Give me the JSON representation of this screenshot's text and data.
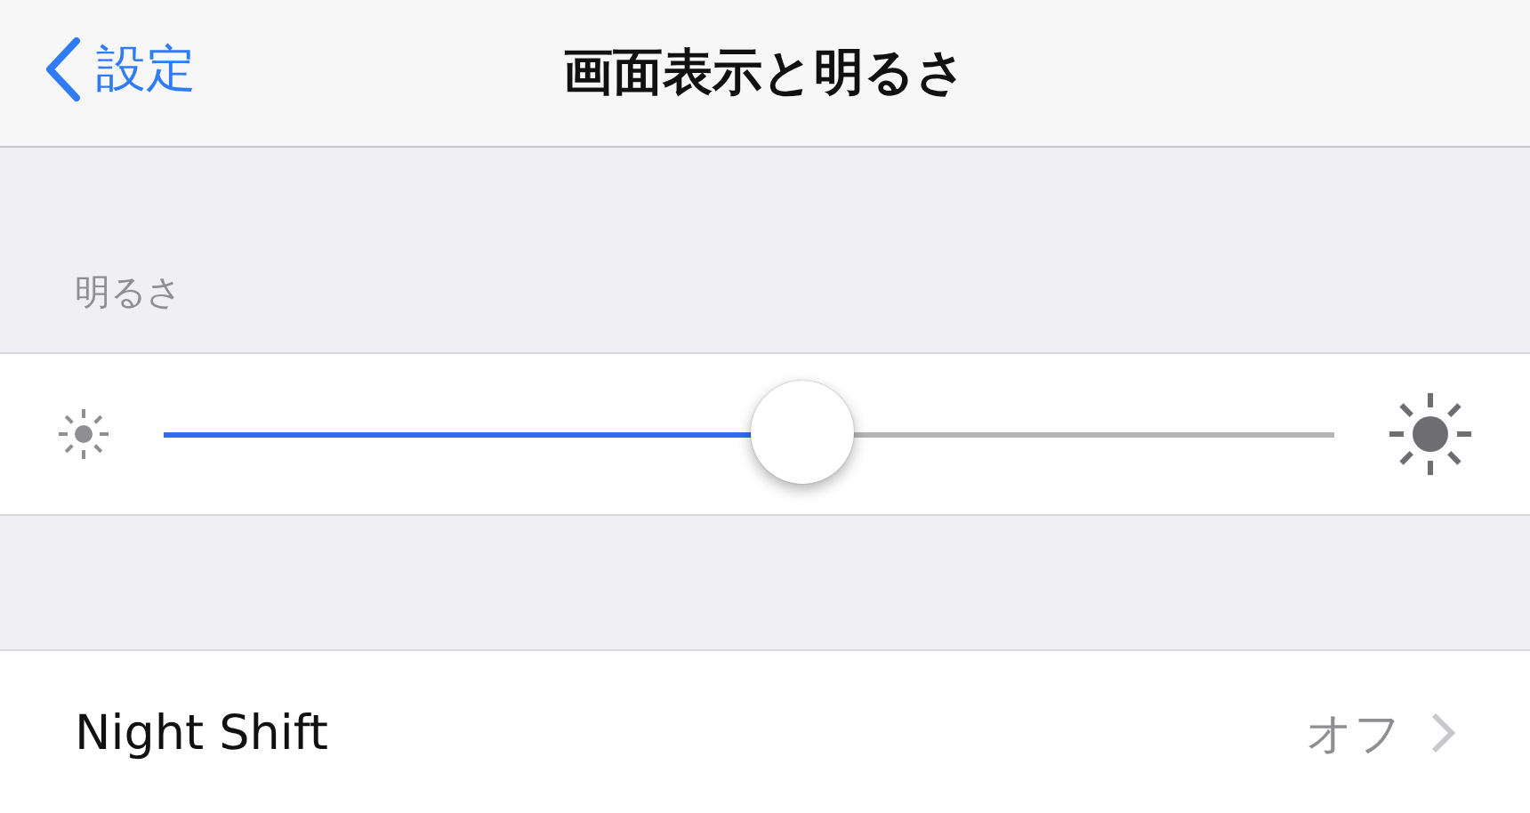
{
  "nav": {
    "back": "設定",
    "title": "画面表示と明るさ"
  },
  "brightness": {
    "header": "明るさ",
    "level": 0.545
  },
  "rows": [
    {
      "label": "Night Shift",
      "value": "オフ"
    }
  ]
}
